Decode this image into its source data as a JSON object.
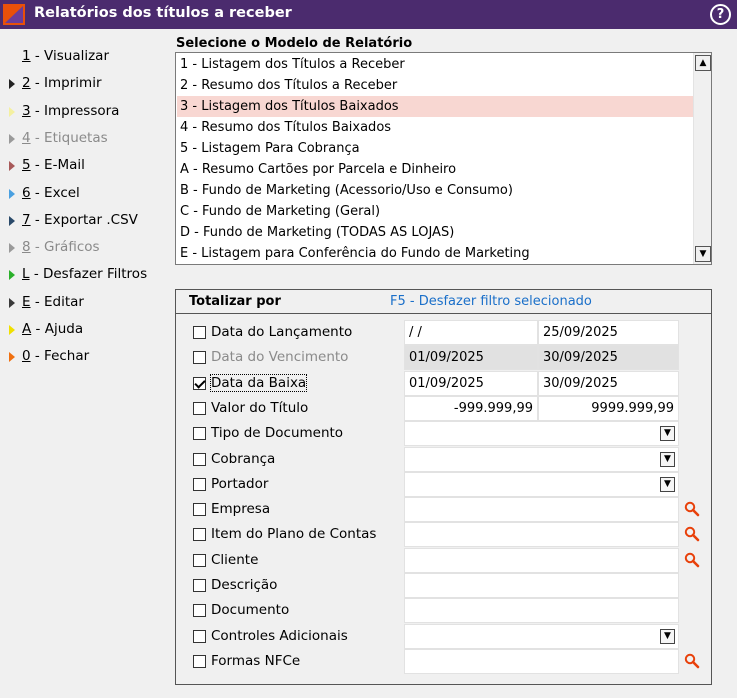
{
  "window": {
    "title": "Relatórios dos títulos a receber",
    "help": "?"
  },
  "sidebar": {
    "items": [
      {
        "key": "1",
        "rest": " - Visualizar",
        "color": "#f0f0f0",
        "disabled": false
      },
      {
        "key": "2",
        "rest": " - Imprimir",
        "color": "#222222",
        "disabled": false
      },
      {
        "key": "3",
        "rest": " - Impressora",
        "color": "#f4f0a0",
        "disabled": false
      },
      {
        "key": "4",
        "rest": " - Etiquetas",
        "color": "#9a9a9a",
        "disabled": true
      },
      {
        "key": "5",
        "rest": " - E-Mail",
        "color": "#a85a5a",
        "disabled": false
      },
      {
        "key": "6",
        "rest": " - Excel",
        "color": "#4aa0e0",
        "disabled": false
      },
      {
        "key": "7",
        "rest": " - Exportar .CSV",
        "color": "#2a4a6a",
        "disabled": false
      },
      {
        "key": "8",
        "rest": " - Gráficos",
        "color": "#9a9a9a",
        "disabled": true
      },
      {
        "key": "L",
        "rest": " - Desfazer Filtros",
        "color": "#2ab02a",
        "disabled": false
      },
      {
        "key": "E",
        "rest": " - Editar",
        "color": "#3a3a3a",
        "disabled": false
      },
      {
        "key": "A",
        "rest": " - Ajuda",
        "color": "#f0e000",
        "disabled": false
      },
      {
        "key": "0",
        "rest": " - Fechar",
        "color": "#f07010",
        "disabled": false
      }
    ]
  },
  "report": {
    "label": "Selecione o Modelo de Relatório",
    "selected_index": 2,
    "items": [
      "1 - Listagem dos Títulos a Receber",
      "2 - Resumo dos Títulos a Receber",
      "3 - Listagem dos Títulos Baixados",
      "4 - Resumo dos Títulos Baixados",
      "5 - Listagem Para Cobrança",
      "A - Resumo Cartões por Parcela e Dinheiro",
      "B - Fundo de Marketing (Acessorio/Uso e Consumo)",
      "C - Fundo de Marketing (Geral)",
      "D - Fundo de Marketing (TODAS AS LOJAS)",
      "E - Listagem para Conferência do Fundo de Marketing"
    ]
  },
  "filters": {
    "totalizar_label": "Totalizar por",
    "f5_label": "F5 - Desfazer filtro selecionado",
    "rows": [
      {
        "label": "Data do Lançamento",
        "checked": false,
        "disabled": false,
        "focus": false,
        "type": "range",
        "from": " /  /",
        "to": "25/09/2025",
        "gray": false
      },
      {
        "label": "Data do Vencimento",
        "checked": false,
        "disabled": true,
        "focus": false,
        "type": "range",
        "from": "01/09/2025",
        "to": "30/09/2025",
        "gray": true
      },
      {
        "label": "Data da Baixa",
        "checked": true,
        "disabled": false,
        "focus": true,
        "type": "range",
        "from": "01/09/2025",
        "to": "30/09/2025",
        "gray": false
      },
      {
        "label": "Valor do Título",
        "checked": false,
        "disabled": false,
        "focus": false,
        "type": "range-num",
        "from": "-999.999,99",
        "to": "9999.999,99",
        "gray": false
      },
      {
        "label": "Tipo de Documento",
        "checked": false,
        "disabled": false,
        "focus": false,
        "type": "combo",
        "value": ""
      },
      {
        "label": "Cobrança",
        "checked": false,
        "disabled": false,
        "focus": false,
        "type": "combo",
        "value": ""
      },
      {
        "label": "Portador",
        "checked": false,
        "disabled": false,
        "focus": false,
        "type": "combo",
        "value": ""
      },
      {
        "label": "Empresa",
        "checked": false,
        "disabled": false,
        "focus": false,
        "type": "search",
        "value": ""
      },
      {
        "label": "Item do Plano de Contas",
        "checked": false,
        "disabled": false,
        "focus": false,
        "type": "search",
        "value": ""
      },
      {
        "label": "Cliente",
        "checked": false,
        "disabled": false,
        "focus": false,
        "type": "search",
        "value": ""
      },
      {
        "label": "Descrição",
        "checked": false,
        "disabled": false,
        "focus": false,
        "type": "text",
        "value": ""
      },
      {
        "label": "Documento",
        "checked": false,
        "disabled": false,
        "focus": false,
        "type": "text",
        "value": ""
      },
      {
        "label": "Controles Adicionais",
        "checked": false,
        "disabled": false,
        "focus": false,
        "type": "combo",
        "value": ""
      },
      {
        "label": "Formas NFCe",
        "checked": false,
        "disabled": false,
        "focus": false,
        "type": "search",
        "value": ""
      }
    ]
  }
}
